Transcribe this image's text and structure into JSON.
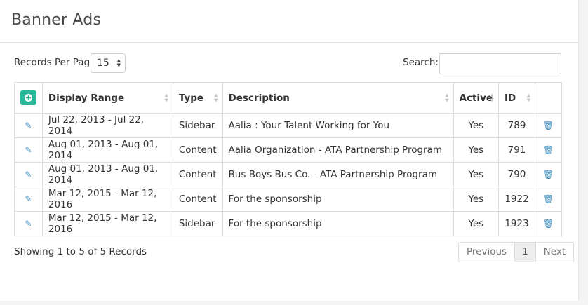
{
  "header": {
    "title": "Banner Ads"
  },
  "controls": {
    "records_label": "Records Per Page",
    "per_page_value": "15",
    "search_label": "Search:",
    "search_value": ""
  },
  "table": {
    "headers": {
      "display_range": "Display Range",
      "type": "Type",
      "description": "Description",
      "active": "Active",
      "id": "ID"
    },
    "rows": [
      {
        "range": "Jul 22, 2013 - Jul 22, 2014",
        "type": "Sidebar",
        "description": "Aalia : Your Talent Working for You",
        "active": "Yes",
        "id": "789"
      },
      {
        "range": "Aug 01, 2013 - Aug 01, 2014",
        "type": "Content",
        "description": "Aalia Organization - ATA Partnership Program",
        "active": "Yes",
        "id": "791"
      },
      {
        "range": "Aug 01, 2013 - Aug 01, 2014",
        "type": "Content",
        "description": "Bus Boys Bus Co. - ATA Partnership Program",
        "active": "Yes",
        "id": "790"
      },
      {
        "range": "Mar 12, 2015 - Mar 12, 2016",
        "type": "Content",
        "description": "For the sponsorship",
        "active": "Yes",
        "id": "1922"
      },
      {
        "range": "Mar 12, 2015 - Mar 12, 2016",
        "type": "Sidebar",
        "description": "For the sponsorship",
        "active": "Yes",
        "id": "1923"
      }
    ]
  },
  "footer": {
    "info": "Showing 1 to 5 of 5 Records",
    "previous": "Previous",
    "page": "1",
    "next": "Next"
  },
  "icons": {
    "add": "plus-circle-icon",
    "edit": "edit-icon",
    "delete": "trash-icon"
  },
  "colors": {
    "accent": "#26b99a",
    "link": "#3c8dbc"
  }
}
